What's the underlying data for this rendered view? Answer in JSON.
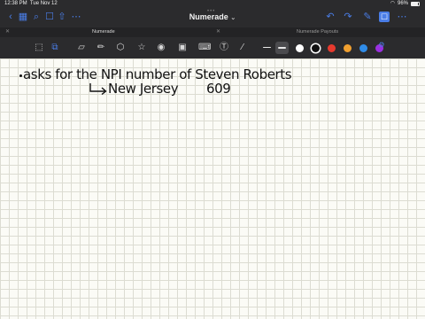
{
  "status_bar": {
    "time": "12:38 PM",
    "date": "Tue Nov 12",
    "battery": "96%"
  },
  "nav": {
    "title": "Numerade",
    "icons": [
      "sidebar-icon",
      "back-icon",
      "grid-icon",
      "search-icon",
      "bookmark-icon",
      "share-icon",
      "undo-icon",
      "redo-icon",
      "edit-icon",
      "add-page-icon",
      "more-icon"
    ]
  },
  "tabs": [
    {
      "label": "Numerade",
      "active": true
    },
    {
      "label": "Numerade Payouts",
      "active": false
    }
  ],
  "toolbar": {
    "tools": [
      "lasso-icon",
      "scan-icon",
      "pen-icon",
      "eraser-icon",
      "highlighter-icon",
      "shapes-icon",
      "elements-icon",
      "image-icon",
      "keyboard-icon",
      "text-icon",
      "laser-icon"
    ],
    "colors": [
      "#ffffff",
      "#111111",
      "#e63a2e",
      "#f0a030",
      "#2f8ce8",
      "#9b30e0"
    ],
    "accent": "#4a7de6"
  },
  "note": {
    "line1": "asks for the NPI number of Steven Roberts",
    "line2": "New Jersey",
    "line2_code": "609"
  }
}
